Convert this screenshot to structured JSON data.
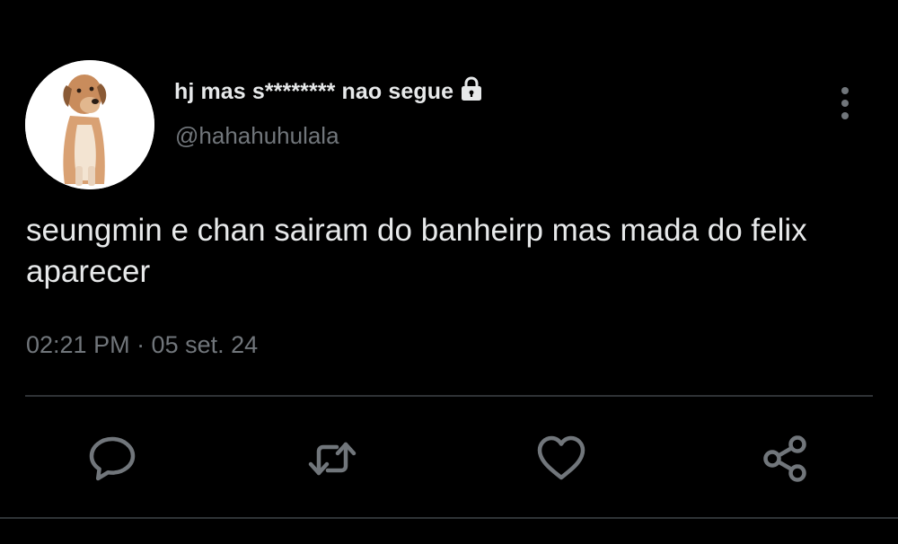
{
  "tweet": {
    "display_name": "hj mas s******** nao segue",
    "handle": "@hahahuhulala",
    "text": "seungmin e chan sairam do banheirp mas mada do felix aparecer",
    "timestamp": "02:21 PM · 05 set. 24"
  },
  "icons": {
    "avatar": "dog-photo",
    "protected": "lock-icon",
    "more": "more-vertical-icon",
    "reply": "reply-icon",
    "retweet": "retweet-icon",
    "like": "heart-icon",
    "share": "share-icon"
  },
  "colors": {
    "background": "#000000",
    "primary_text": "#e7e9ea",
    "secondary_text": "#71767b",
    "divider": "#2f3336"
  }
}
